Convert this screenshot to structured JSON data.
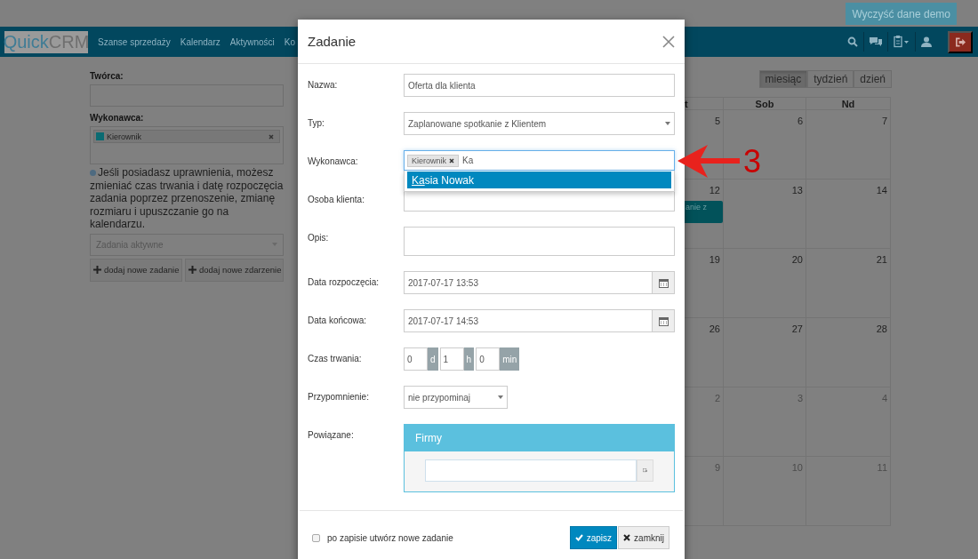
{
  "top_bar": {
    "clear_demo_button": "Wyczyść dane demo"
  },
  "navbar": {
    "logo": {
      "part_1": "Quick",
      "part_2": "CRM"
    },
    "items": [
      "Szanse sprzedaży",
      "Kalendarz",
      "Aktywności",
      "Ko"
    ]
  },
  "sidebar": {
    "creator_label": "Twórca:",
    "assignee_label": "Wykonawca:",
    "assignee_tags": [
      {
        "label": "Kierownik",
        "color": "#0b6b72",
        "removable": true
      }
    ],
    "info_text": "Jeśli posiadasz uprawnienia, możesz zmieniać czas trwania i datę rozpoczęcia zadania poprzez przenoszenie, zmianę rozmiaru i upuszczanie go na kalendarzu.",
    "filter_select": "Zadania aktywne",
    "buttons": [
      "dodaj nowe zadanie",
      "dodaj nowe zdarzenie"
    ]
  },
  "calendar": {
    "views": [
      {
        "label": "miesiąc",
        "selected": true
      },
      {
        "label": "tydzień",
        "selected": false
      },
      {
        "label": "dzień",
        "selected": false
      }
    ],
    "columns": [
      "t",
      "Sob",
      "Nd"
    ],
    "weeks": [
      {
        "days": [
          {
            "number": "5",
            "other_month": false
          },
          {
            "number": "6",
            "other_month": false
          },
          {
            "number": "7",
            "other_month": false
          }
        ]
      },
      {
        "days": [
          {
            "number": "12",
            "other_month": false
          },
          {
            "number": "13",
            "other_month": false
          },
          {
            "number": "14",
            "other_month": false
          }
        ],
        "event": "anie z"
      },
      {
        "days": [
          {
            "number": "19",
            "other_month": false
          },
          {
            "number": "20",
            "other_month": false
          },
          {
            "number": "21",
            "other_month": false
          }
        ]
      },
      {
        "days": [
          {
            "number": "26",
            "other_month": false
          },
          {
            "number": "27",
            "other_month": false
          },
          {
            "number": "28",
            "other_month": false
          }
        ]
      },
      {
        "days": [
          {
            "number": "2",
            "other_month": true
          },
          {
            "number": "3",
            "other_month": true
          },
          {
            "number": "4",
            "other_month": true
          }
        ]
      },
      {
        "days": [
          {
            "number": "9",
            "other_month": true
          },
          {
            "number": "10",
            "other_month": true
          },
          {
            "number": "11",
            "other_month": true
          }
        ]
      }
    ]
  },
  "modal": {
    "title": "Zadanie",
    "fields": [
      {
        "label": "Nazwa:",
        "kind": "text",
        "value": "Oferta dla klienta"
      },
      {
        "label": "Typ:",
        "kind": "select",
        "value": "Zaplanowane spotkanie z Klientem"
      },
      {
        "label": "Wykonawca:",
        "kind": "tags",
        "tags": [
          "Kierownik"
        ],
        "value": "Ka",
        "focused": true,
        "suggestions": [
          {
            "match": "Ka",
            "rest": "sia Nowak",
            "selected": true
          }
        ]
      },
      {
        "label": "Osoba klienta:",
        "kind": "text"
      },
      {
        "label": "Opis:",
        "kind": "textarea"
      },
      {
        "label": "Data rozpoczęcia:",
        "kind": "date",
        "value": "2017-07-17 13:53"
      },
      {
        "label": "Data końcowa:",
        "kind": "date",
        "value": "2017-07-17 14:53"
      },
      {
        "label": "Czas trwania:",
        "kind": "duration",
        "parts": [
          {
            "value": "0",
            "unit": "d"
          },
          {
            "value": "1",
            "unit": "h"
          },
          {
            "value": "0",
            "unit": "min"
          }
        ]
      },
      {
        "label": "Przypomnienie:",
        "kind": "select_small",
        "value": "nie przypominaj"
      },
      {
        "label": "Powiązane:",
        "kind": "panel",
        "panel_title": "Firmy"
      }
    ],
    "footer": {
      "checkbox": {
        "label": "po zapisie utwórz nowe zadanie",
        "checked": false
      },
      "buttons": [
        {
          "label": "zapisz",
          "kind": "primary"
        },
        {
          "label": "zamknij",
          "kind": "default"
        }
      ]
    }
  },
  "annotation": {
    "label": "3"
  }
}
